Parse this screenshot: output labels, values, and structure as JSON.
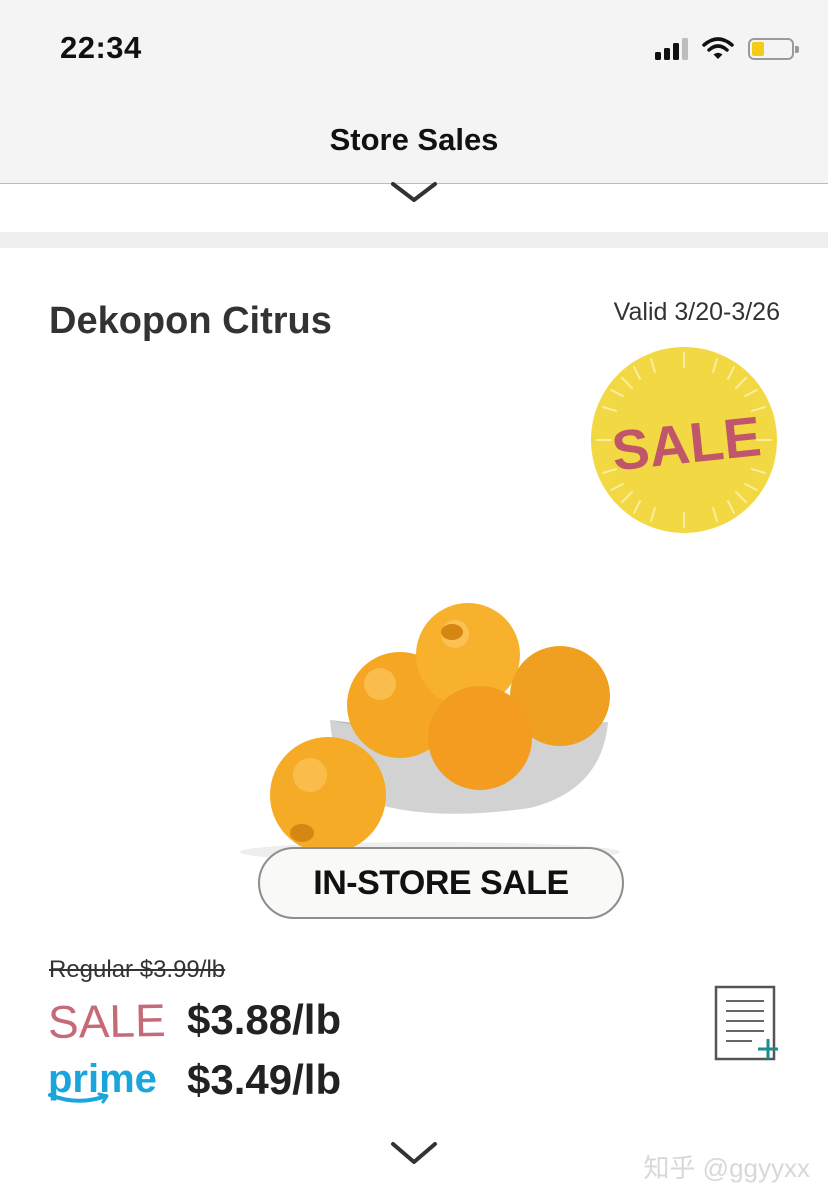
{
  "status_bar": {
    "time": "22:34",
    "icons": [
      "signal-icon",
      "wifi-icon",
      "battery-icon"
    ],
    "battery_color": "#f3cc1a"
  },
  "nav": {
    "title": "Store Sales"
  },
  "product": {
    "name": "Dekopon Citrus",
    "validity": "Valid 3/20-3/26",
    "badge_text": "SALE",
    "badge_color": "#f2d843",
    "badge_text_color": "#c0566a",
    "tag": "IN-STORE SALE",
    "regular_price": "Regular $3.99/lb",
    "sale_label": "SALE",
    "sale_price": "$3.88/lb",
    "prime_label": "prime",
    "prime_price": "$3.49/lb",
    "sale_color": "#c66a78",
    "prime_color": "#1aa5dc"
  },
  "watermark": "知乎 @ggyyxx"
}
